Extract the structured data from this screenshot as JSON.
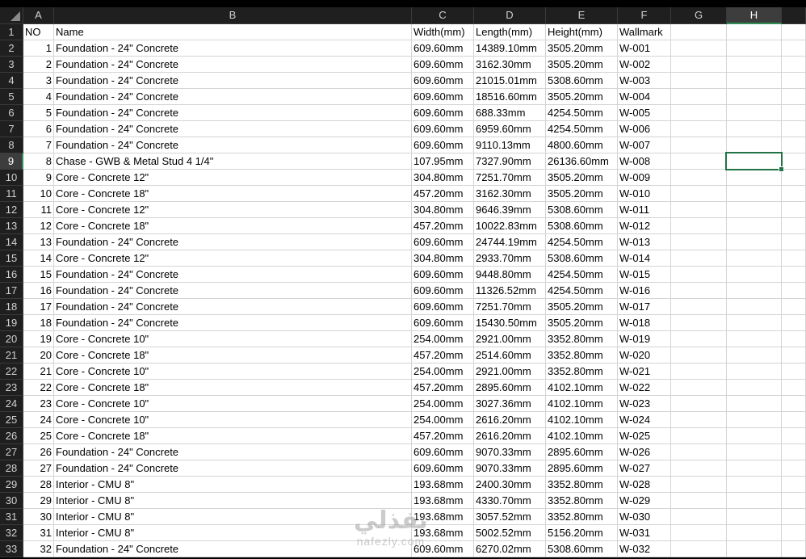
{
  "columns": [
    "A",
    "B",
    "C",
    "D",
    "E",
    "F",
    "G",
    "H"
  ],
  "selected_column": "H",
  "selected_row": 9,
  "headers": {
    "no": "NO",
    "name": "Name",
    "width": "Width(mm)",
    "length": "Length(mm)",
    "height": "Height(mm)",
    "wallmark": "Wallmark"
  },
  "rows": [
    {
      "no": "1",
      "name": "Foundation - 24\" Concrete",
      "width": "609.60mm",
      "length": "14389.10mm",
      "height": "3505.20mm",
      "wallmark": "W-001"
    },
    {
      "no": "2",
      "name": "Foundation - 24\" Concrete",
      "width": "609.60mm",
      "length": "3162.30mm",
      "height": "3505.20mm",
      "wallmark": "W-002"
    },
    {
      "no": "3",
      "name": "Foundation - 24\" Concrete",
      "width": "609.60mm",
      "length": "21015.01mm",
      "height": "5308.60mm",
      "wallmark": "W-003"
    },
    {
      "no": "4",
      "name": "Foundation - 24\" Concrete",
      "width": "609.60mm",
      "length": "18516.60mm",
      "height": "3505.20mm",
      "wallmark": "W-004"
    },
    {
      "no": "5",
      "name": "Foundation - 24\" Concrete",
      "width": "609.60mm",
      "length": "688.33mm",
      "height": "4254.50mm",
      "wallmark": "W-005"
    },
    {
      "no": "6",
      "name": "Foundation - 24\" Concrete",
      "width": "609.60mm",
      "length": "6959.60mm",
      "height": "4254.50mm",
      "wallmark": "W-006"
    },
    {
      "no": "7",
      "name": "Foundation - 24\" Concrete",
      "width": "609.60mm",
      "length": "9110.13mm",
      "height": "4800.60mm",
      "wallmark": "W-007"
    },
    {
      "no": "8",
      "name": "Chase - GWB & Metal Stud 4 1/4\"",
      "width": "107.95mm",
      "length": "7327.90mm",
      "height": "26136.60mm",
      "wallmark": "W-008"
    },
    {
      "no": "9",
      "name": "Core - Concrete 12\"",
      "width": "304.80mm",
      "length": "7251.70mm",
      "height": "3505.20mm",
      "wallmark": "W-009"
    },
    {
      "no": "10",
      "name": "Core - Concrete 18\"",
      "width": "457.20mm",
      "length": "3162.30mm",
      "height": "3505.20mm",
      "wallmark": "W-010"
    },
    {
      "no": "11",
      "name": "Core - Concrete 12\"",
      "width": "304.80mm",
      "length": "9646.39mm",
      "height": "5308.60mm",
      "wallmark": "W-011"
    },
    {
      "no": "12",
      "name": "Core - Concrete 18\"",
      "width": "457.20mm",
      "length": "10022.83mm",
      "height": "5308.60mm",
      "wallmark": "W-012"
    },
    {
      "no": "13",
      "name": "Foundation - 24\" Concrete",
      "width": "609.60mm",
      "length": "24744.19mm",
      "height": "4254.50mm",
      "wallmark": "W-013"
    },
    {
      "no": "14",
      "name": "Core - Concrete 12\"",
      "width": "304.80mm",
      "length": "2933.70mm",
      "height": "5308.60mm",
      "wallmark": "W-014"
    },
    {
      "no": "15",
      "name": "Foundation - 24\" Concrete",
      "width": "609.60mm",
      "length": "9448.80mm",
      "height": "4254.50mm",
      "wallmark": "W-015"
    },
    {
      "no": "16",
      "name": "Foundation - 24\" Concrete",
      "width": "609.60mm",
      "length": "11326.52mm",
      "height": "4254.50mm",
      "wallmark": "W-016"
    },
    {
      "no": "17",
      "name": "Foundation - 24\" Concrete",
      "width": "609.60mm",
      "length": "7251.70mm",
      "height": "3505.20mm",
      "wallmark": "W-017"
    },
    {
      "no": "18",
      "name": "Foundation - 24\" Concrete",
      "width": "609.60mm",
      "length": "15430.50mm",
      "height": "3505.20mm",
      "wallmark": "W-018"
    },
    {
      "no": "19",
      "name": "Core - Concrete 10\"",
      "width": "254.00mm",
      "length": "2921.00mm",
      "height": "3352.80mm",
      "wallmark": "W-019"
    },
    {
      "no": "20",
      "name": "Core - Concrete 18\"",
      "width": "457.20mm",
      "length": "2514.60mm",
      "height": "3352.80mm",
      "wallmark": "W-020"
    },
    {
      "no": "21",
      "name": "Core - Concrete 10\"",
      "width": "254.00mm",
      "length": "2921.00mm",
      "height": "3352.80mm",
      "wallmark": "W-021"
    },
    {
      "no": "22",
      "name": "Core - Concrete 18\"",
      "width": "457.20mm",
      "length": "2895.60mm",
      "height": "4102.10mm",
      "wallmark": "W-022"
    },
    {
      "no": "23",
      "name": "Core - Concrete 10\"",
      "width": "254.00mm",
      "length": "3027.36mm",
      "height": "4102.10mm",
      "wallmark": "W-023"
    },
    {
      "no": "24",
      "name": "Core - Concrete 10\"",
      "width": "254.00mm",
      "length": "2616.20mm",
      "height": "4102.10mm",
      "wallmark": "W-024"
    },
    {
      "no": "25",
      "name": "Core - Concrete 18\"",
      "width": "457.20mm",
      "length": "2616.20mm",
      "height": "4102.10mm",
      "wallmark": "W-025"
    },
    {
      "no": "26",
      "name": "Foundation - 24\" Concrete",
      "width": "609.60mm",
      "length": "9070.33mm",
      "height": "2895.60mm",
      "wallmark": "W-026"
    },
    {
      "no": "27",
      "name": "Foundation - 24\" Concrete",
      "width": "609.60mm",
      "length": "9070.33mm",
      "height": "2895.60mm",
      "wallmark": "W-027"
    },
    {
      "no": "28",
      "name": "Interior - CMU 8\"",
      "width": "193.68mm",
      "length": "2400.30mm",
      "height": "3352.80mm",
      "wallmark": "W-028"
    },
    {
      "no": "29",
      "name": "Interior - CMU 8\"",
      "width": "193.68mm",
      "length": "4330.70mm",
      "height": "3352.80mm",
      "wallmark": "W-029"
    },
    {
      "no": "30",
      "name": "Interior - CMU 8\"",
      "width": "193.68mm",
      "length": "3057.52mm",
      "height": "3352.80mm",
      "wallmark": "W-030"
    },
    {
      "no": "31",
      "name": "Interior - CMU 8\"",
      "width": "193.68mm",
      "length": "5002.52mm",
      "height": "5156.20mm",
      "wallmark": "W-031"
    },
    {
      "no": "32",
      "name": "Foundation - 24\" Concrete",
      "width": "609.60mm",
      "length": "6270.02mm",
      "height": "5308.60mm",
      "wallmark": "W-032"
    }
  ],
  "watermark": {
    "logo_text": "نفذلي",
    "url_text": "nafezly.com"
  }
}
